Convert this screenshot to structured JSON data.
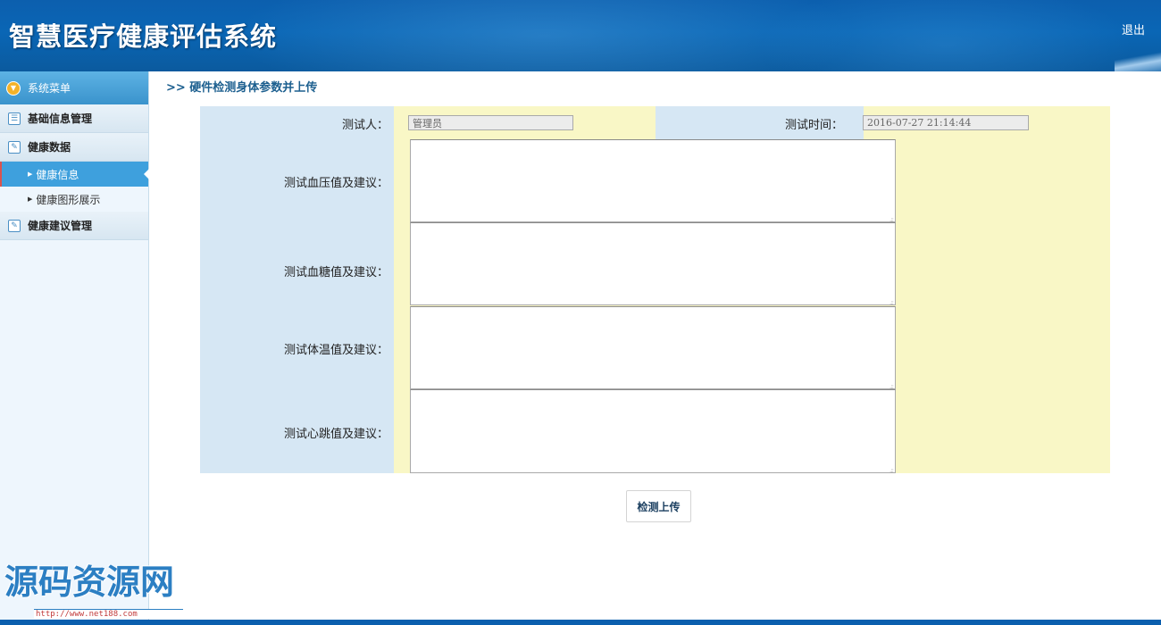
{
  "header": {
    "title": "智慧医疗健康评估系统",
    "logout_label": "退出"
  },
  "sidebar": {
    "menu_title": "系统菜单",
    "groups": [
      {
        "label": "基础信息管理",
        "icon": "list-icon"
      },
      {
        "label": "健康数据",
        "icon": "edit-icon",
        "items": [
          {
            "label": "健康信息",
            "active": true
          },
          {
            "label": "健康图形展示",
            "active": false
          }
        ]
      },
      {
        "label": "健康建议管理",
        "icon": "edit-icon"
      }
    ]
  },
  "breadcrumb": ">> 硬件检测身体参数并上传",
  "form": {
    "tester_label": "测试人：",
    "tester_value": "管理员",
    "time_label": "测试时间：",
    "time_value": "2016-07-27 21:14:44",
    "blood_pressure_label": "测试血压值及建议：",
    "blood_sugar_label": "测试血糖值及建议：",
    "temperature_label": "测试体温值及建议：",
    "heart_rate_label": "测试心跳值及建议：",
    "submit_label": "检测上传"
  },
  "watermark": {
    "text": "源码资源网",
    "url": "http://www.net188.com"
  },
  "colors": {
    "header_bg": "#0a66b5",
    "label_cell_bg": "#d6e7f4",
    "value_cell_bg": "#f9f7c6",
    "sidebar_active": "#3ea0dd"
  }
}
